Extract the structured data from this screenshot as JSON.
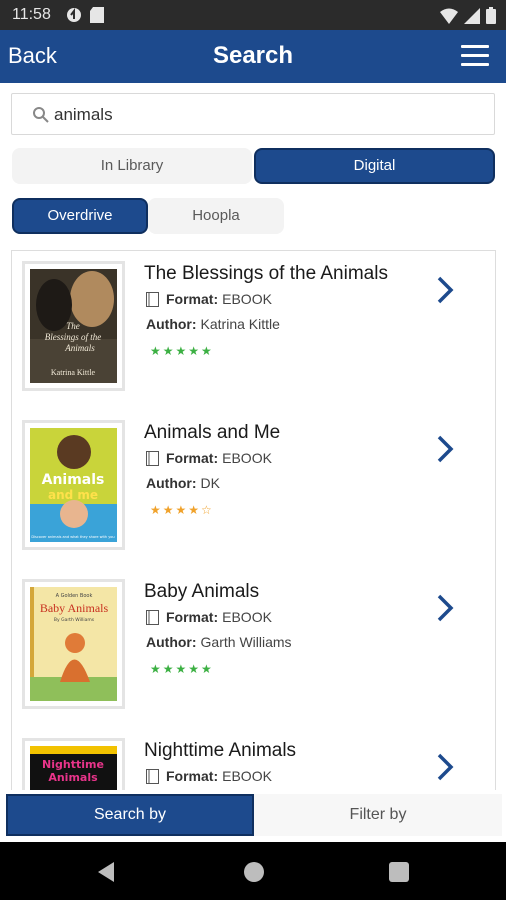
{
  "status_bar": {
    "time": "11:58"
  },
  "header": {
    "back_label": "Back",
    "title": "Search"
  },
  "search": {
    "value": "animals",
    "placeholder": ""
  },
  "source_tabs": [
    {
      "label": "In Library",
      "active": false
    },
    {
      "label": "Digital",
      "active": true
    }
  ],
  "provider_tabs": [
    {
      "label": "Overdrive",
      "active": true
    },
    {
      "label": "Hoopla",
      "active": false
    }
  ],
  "labels": {
    "format": "Format:",
    "author": "Author:"
  },
  "results": [
    {
      "title": "The Blessings of the Animals",
      "format": "EBOOK",
      "author": "Katrina Kittle",
      "rating": "★★★★★",
      "rating_color": "#3cb043",
      "cover_lines": [
        "The",
        "Blessings of the",
        "Animals",
        "Katrina Kittle"
      ]
    },
    {
      "title": "Animals and Me",
      "format": "EBOOK",
      "author": "DK",
      "rating": "★★★★☆",
      "rating_color": "#f0a22b",
      "cover_lines": [
        "Animals",
        "and me",
        "Discover animals and what they share with you"
      ]
    },
    {
      "title": "Baby Animals",
      "format": "EBOOK",
      "author": "Garth Williams",
      "rating": "★★★★★",
      "rating_color": "#3cb043",
      "cover_lines": [
        "A Golden Book",
        "Baby Animals",
        "By Garth Williams"
      ]
    },
    {
      "title": "Nighttime Animals",
      "format": "EBOOK",
      "author": "",
      "rating": "",
      "rating_color": "#3cb043",
      "cover_lines": [
        "Nighttime",
        "Animals"
      ]
    }
  ],
  "bottom_tabs": [
    {
      "label": "Search by",
      "active": true
    },
    {
      "label": "Filter by",
      "active": false
    }
  ],
  "colors": {
    "primary": "#1d4a8d",
    "star_green": "#3cb043",
    "star_orange": "#f0a22b"
  }
}
